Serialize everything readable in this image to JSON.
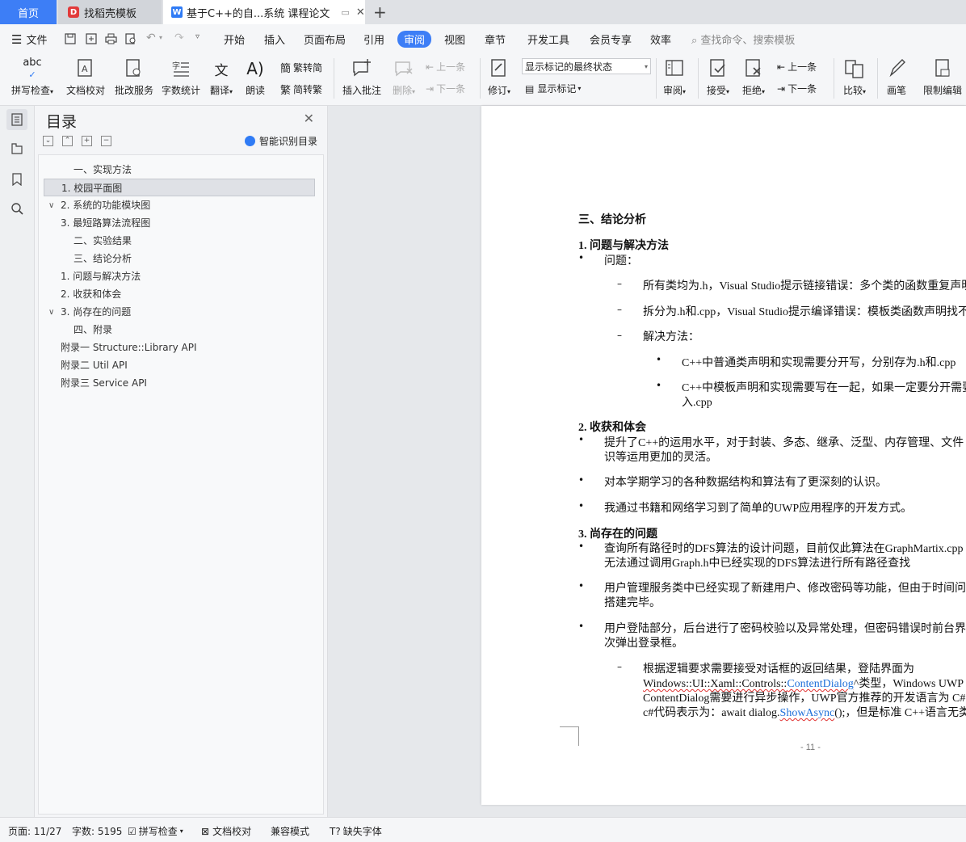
{
  "tabs": {
    "home": "首页",
    "template": "找稻壳模板",
    "document": "基于C++的自...系统 课程论文"
  },
  "menu": {
    "file": "文件",
    "items": [
      "开始",
      "插入",
      "页面布局",
      "引用",
      "审阅",
      "视图",
      "章节",
      "开发工具",
      "会员专享",
      "效率"
    ],
    "active": "审阅",
    "search_placeholder": "查找命令、搜索模板"
  },
  "ribbon": {
    "spellcheck": "拼写检查",
    "doc_proof": "文档校对",
    "batch_service": "批改服务",
    "word_count": "字数统计",
    "translate": "翻译",
    "read_aloud": "朗读",
    "trad_to_simp": "繁转简",
    "simp_to_trad": "简转繁",
    "insert_comment": "插入批注",
    "delete": "删除",
    "prev_comment": "上一条",
    "next_comment": "下一条",
    "track_changes": "修订",
    "markup_select": "显示标记的最终状态",
    "show_markup": "显示标记",
    "review_pane": "审阅",
    "accept": "接受",
    "reject": "拒绝",
    "prev_change": "上一条",
    "next_change": "下一条",
    "compare": "比较",
    "pen": "画笔",
    "restrict_edit": "限制编辑"
  },
  "toc": {
    "title": "目录",
    "smart_label": "智能识别目录",
    "items": [
      "一、实现方法",
      "1. 校园平面图",
      "2. 系统的功能模块图",
      "3. 最短路算法流程图",
      "二、实验结果",
      "三、结论分析",
      "1. 问题与解决方法",
      "2. 收获和体会",
      "3. 尚存在的问题",
      "四、附录",
      "附录一 Structure::Library API",
      "附录二 Util API",
      "附录三 Service API"
    ]
  },
  "doc": {
    "heading": "三、结论分析",
    "s1_title": "1. 问题与解决方法",
    "s1_problem": "问题：",
    "s1_p1": "所有类均为.h，Visual Studio提示链接错误：多个类的函数重复声明",
    "s1_p2": "拆分为.h和.cpp，Visual Studio提示编译错误：模板类函数声明找不到",
    "s1_solution": "解决方法：",
    "s1_sol1": "C++中普通类声明和实现需要分开写，分别存为.h和.cpp",
    "s1_sol2a": "C++中模板声明和实现需要写在一起，如果一定要分开需要",
    "s1_sol2b": "入.cpp",
    "s2_title": "2. 收获和体会",
    "s2_b1a": "提升了C++的运用水平，对于封装、多态、继承、泛型、内存管理、文件",
    "s2_b1b": "识等运用更加的灵活。",
    "s2_b2": "对本学期学习的各种数据结构和算法有了更深刻的认识。",
    "s2_b3": "我通过书籍和网络学习到了简单的UWP应用程序的开发方式。",
    "s3_title": "3. 尚存在的问题",
    "s3_b1a": "查询所有路径时的DFS算法的设计问题，目前仅此算法在GraphMartix.cpp",
    "s3_b1b": "无法通过调用Graph.h中已经实现的DFS算法进行所有路径查找",
    "s3_b2a": "用户管理服务类中已经实现了新建用户、修改密码等功能，但由于时间问",
    "s3_b2b": "搭建完毕。",
    "s3_b3a": "用户登陆部分，后台进行了密码校验以及异常处理，但密码错误时前台界",
    "s3_b3b": "次弹出登录框。",
    "s3_d1a": "根据逻辑要求需要接受对话框的返回结果，登陆界面为",
    "s3_d1b_1": "Windows::UI::Xaml::Controls::",
    "s3_d1b_2": "ContentDialog",
    "s3_d1b_3": "^类型，Windows UWP",
    "s3_d1c": "ContentDialog需要进行异步操作，UWP官方推荐的开发语言为 C#",
    "s3_d1d_1": "c#代码表示为：await dialog.",
    "s3_d1d_2": "ShowAsync",
    "s3_d1d_3": "();，但是标准 C++语言无类",
    "page_number": "- 11 -"
  },
  "status": {
    "page": "页面: 11/27",
    "words": "字数: 5195",
    "spellcheck": "拼写检查",
    "doc_proof": "文档校对",
    "compat": "兼容模式",
    "missing_font": "缺失字体"
  }
}
